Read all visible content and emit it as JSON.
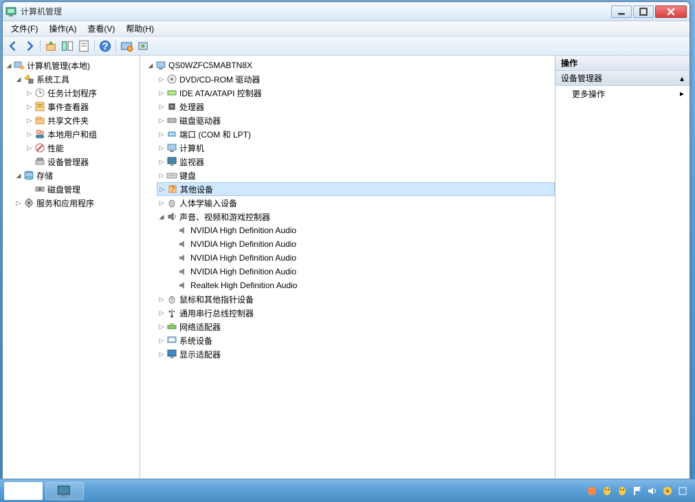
{
  "window": {
    "title": "计算机管理"
  },
  "menu": {
    "file": "文件(F)",
    "action": "操作(A)",
    "view": "查看(V)",
    "help": "帮助(H)"
  },
  "leftTree": {
    "root": {
      "label": "计算机管理(本地)",
      "icon": "computer-mgmt"
    },
    "sysTools": {
      "label": "系统工具",
      "icon": "tools"
    },
    "taskSched": {
      "label": "任务计划程序",
      "icon": "task"
    },
    "eventViewer": {
      "label": "事件查看器",
      "icon": "event"
    },
    "sharedFolders": {
      "label": "共享文件夹",
      "icon": "shared"
    },
    "localUsers": {
      "label": "本地用户和组",
      "icon": "users"
    },
    "perf": {
      "label": "性能",
      "icon": "perf"
    },
    "devMgr": {
      "label": "设备管理器",
      "icon": "device"
    },
    "storage": {
      "label": "存储",
      "icon": "storage"
    },
    "diskMgmt": {
      "label": "磁盘管理",
      "icon": "disk"
    },
    "services": {
      "label": "服务和应用程序",
      "icon": "services"
    }
  },
  "midTree": {
    "root": {
      "label": "QS0WZFC5MABTN8X",
      "icon": "computer"
    },
    "dvd": {
      "label": "DVD/CD-ROM 驱动器",
      "icon": "dvd"
    },
    "ide": {
      "label": "IDE ATA/ATAPI 控制器",
      "icon": "ide"
    },
    "cpu": {
      "label": "处理器",
      "icon": "cpu"
    },
    "diskDrive": {
      "label": "磁盘驱动器",
      "icon": "diskdrive"
    },
    "ports": {
      "label": "端口 (COM 和 LPT)",
      "icon": "port"
    },
    "computer": {
      "label": "计算机",
      "icon": "pc"
    },
    "monitor": {
      "label": "监视器",
      "icon": "monitor"
    },
    "keyboard": {
      "label": "键盘",
      "icon": "keyboard"
    },
    "other": {
      "label": "其他设备",
      "icon": "other"
    },
    "hid": {
      "label": "人体学输入设备",
      "icon": "hid"
    },
    "sound": {
      "label": "声音、视频和游戏控制器",
      "icon": "sound"
    },
    "sound1": {
      "label": "NVIDIA High Definition Audio",
      "icon": "sound"
    },
    "sound2": {
      "label": "NVIDIA High Definition Audio",
      "icon": "sound"
    },
    "sound3": {
      "label": "NVIDIA High Definition Audio",
      "icon": "sound"
    },
    "sound4": {
      "label": "NVIDIA High Definition Audio",
      "icon": "sound"
    },
    "sound5": {
      "label": "Realtek High Definition Audio",
      "icon": "sound"
    },
    "mouse": {
      "label": "鼠标和其他指针设备",
      "icon": "mouse"
    },
    "usb": {
      "label": "通用串行总线控制器",
      "icon": "usb"
    },
    "net": {
      "label": "网络适配器",
      "icon": "net"
    },
    "sysdev": {
      "label": "系统设备",
      "icon": "sysdev"
    },
    "display": {
      "label": "显示适配器",
      "icon": "display"
    }
  },
  "rightPanel": {
    "header": "操作",
    "section": "设备管理器",
    "moreActions": "更多操作"
  }
}
